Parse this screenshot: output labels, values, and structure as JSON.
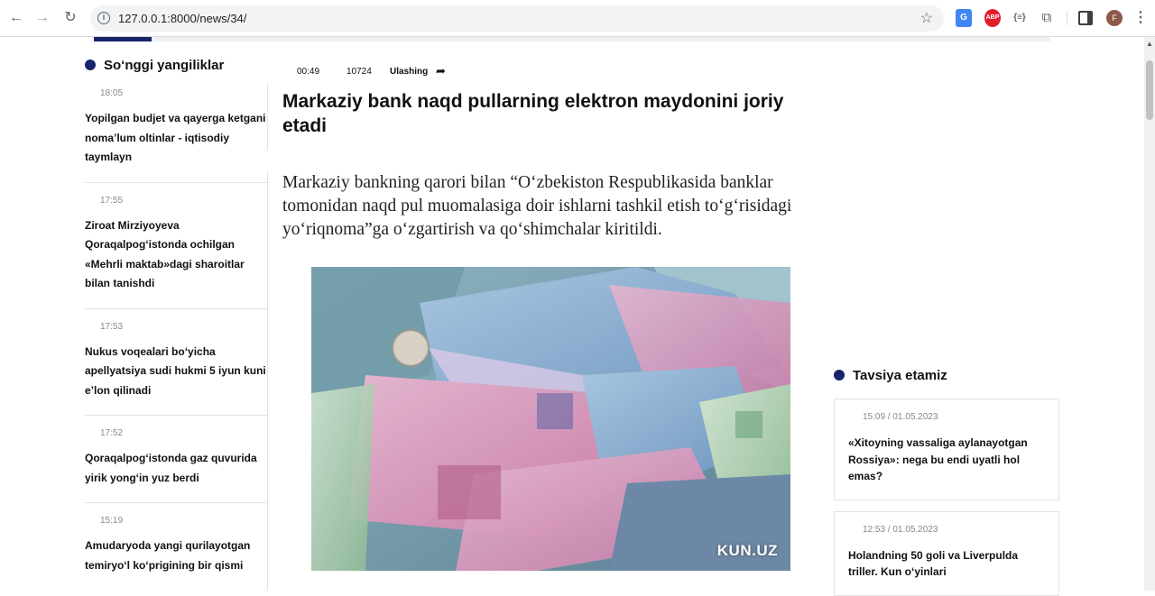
{
  "browser": {
    "url": "127.0.0.1:8000/news/34/",
    "avatar_letter": "F",
    "extensions": [
      "translate-icon",
      "adblock-icon",
      "json-icon",
      "puzzle-icon"
    ]
  },
  "latest": {
    "heading": "So‘nggi yangiliklar",
    "items": [
      {
        "time": "18:05",
        "title": "Yopilgan budjet va qayerga ketgani noma’lum oltinlar - iqtisodiy taymlayn"
      },
      {
        "time": "17:55",
        "title": "Ziroat Mirziyoyeva Qoraqalpog‘istonda ochilgan «Mehrli maktab»dagi sharoitlar bilan tanishdi"
      },
      {
        "time": "17:53",
        "title": "Nukus voqealari bo‘yicha apellyatsiya sudi hukmi 5 iyun kuni e’lon qilinadi"
      },
      {
        "time": "17:52",
        "title": "Qoraqalpog‘istonda gaz quvurida yirik yong‘in yuz berdi"
      },
      {
        "time": "15:19",
        "title": "Amudaryoda yangi qurilayotgan temiryo‘l ko‘prigining bir qismi"
      }
    ]
  },
  "article": {
    "time": "00:49",
    "views": "10724",
    "share_label": "Ulashing",
    "title": "Markaziy bank naqd pullarning elektron maydonini joriy etadi",
    "lead": "Markaziy bankning qarori bilan “O‘zbekiston Respublikasida banklar tomonidan naqd pul muomalasiga doir ishlarni tashkil etish to‘g‘risidagi yo‘riqnoma”ga o‘zgartirish va qo‘shimchalar kiritildi.",
    "image_watermark": "KUN.UZ"
  },
  "recommend": {
    "heading": "Tavsiya etamiz",
    "items": [
      {
        "time": "15:09 / 01.05.2023",
        "title": "«Xitoyning vassaliga aylanayotgan Rossiya»: nega bu endi uyatli hol emas?"
      },
      {
        "time": "12:53 / 01.05.2023",
        "title": "Holandning 50 goli va Liverpulda triller. Kun o‘yinlari"
      }
    ]
  },
  "colors": {
    "accent": "#16256b"
  }
}
